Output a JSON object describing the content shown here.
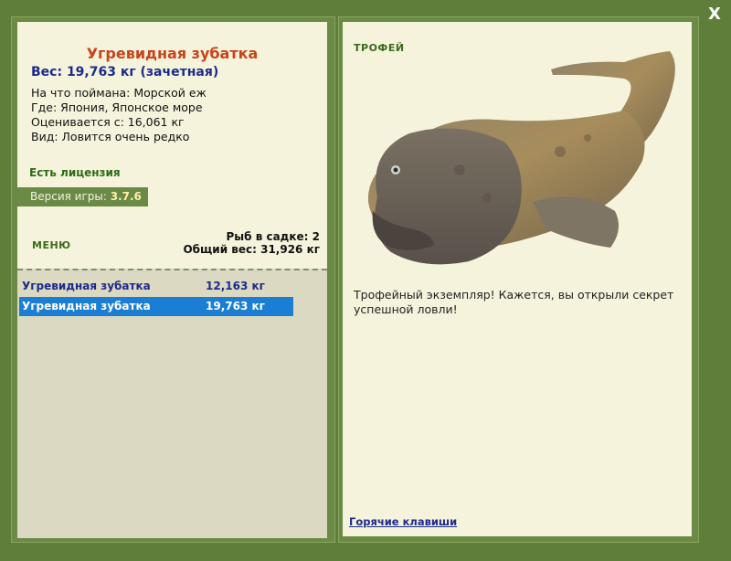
{
  "window": {
    "close_label": "X"
  },
  "fish_info": {
    "name": "Угревидная зубатка",
    "weight": "Вес: 19,763 кг (зачетная)",
    "lines": [
      "На что поймана: Морской еж",
      "Где: Япония, Японское море",
      "Оценивается с: 16,061 кг",
      "Вид: Ловится очень редко"
    ],
    "license": "Есть лицензия",
    "version_label": "Версия игры:",
    "version_value": "3.7.6"
  },
  "menu": {
    "label": "МЕНЮ"
  },
  "stats": {
    "count": "Рыб в садке: 2",
    "total_weight": "Общий вес: 31,926 кг"
  },
  "catch_list": [
    {
      "name": "Угревидная зубатка",
      "weight": "12,163 кг",
      "selected": false
    },
    {
      "name": "Угревидная зубатка",
      "weight": "19,763 кг",
      "selected": true
    }
  ],
  "trophy": {
    "title": "ТРОФЕЙ",
    "description": "Трофейный экземпляр! Кажется, вы открыли секрет успешной ловли!",
    "hotkeys_link": "Горячие клавиши"
  },
  "colors": {
    "background": "#5f7e3a",
    "panel": "#f5f3dc",
    "title": "#c8441a",
    "selection": "#1a7fd4",
    "accent_green": "#3b6a1c"
  },
  "icons": {
    "close": "close-icon",
    "fish": "wolf-eel-fish-image"
  }
}
